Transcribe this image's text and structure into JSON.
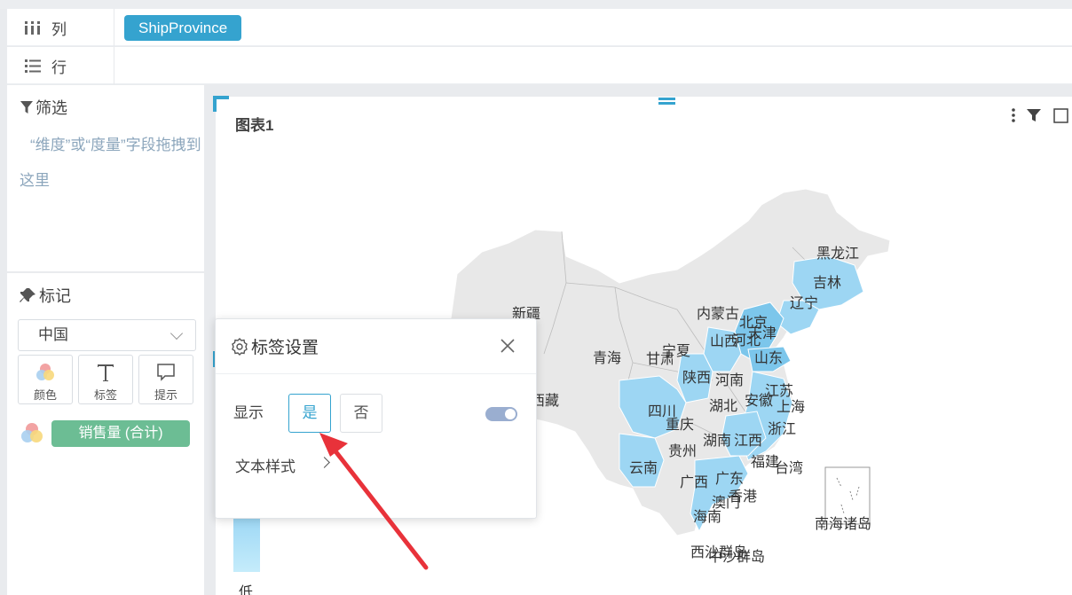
{
  "shelves": {
    "columns_label": "列",
    "columns_field": "ShipProvince",
    "rows_label": "行"
  },
  "filter": {
    "title": "筛选",
    "hint": "“维度”或“度量”字段拖拽到这里"
  },
  "marks": {
    "title": "标记",
    "map_select": "中国",
    "buttons": [
      {
        "label": "颜色",
        "icon": "color-circles-icon"
      },
      {
        "label": "标签",
        "icon": "text-T-icon"
      },
      {
        "label": "提示",
        "icon": "tooltip-bubble-icon"
      }
    ],
    "measure": "销售量 (合计)"
  },
  "chart": {
    "title": "图表1",
    "legend_low": "低",
    "labels": [
      "黑龙江",
      "吉林",
      "辽宁",
      "内蒙古",
      "北京",
      "天津",
      "河北",
      "山西",
      "宁夏",
      "新疆",
      "青海",
      "甘肃",
      "山东",
      "陕西",
      "河南",
      "江苏",
      "安徽",
      "上海",
      "西藏",
      "四川",
      "湖北",
      "重庆",
      "浙江",
      "湖南",
      "江西",
      "贵州",
      "福建",
      "台湾",
      "云南",
      "广西",
      "广东",
      "香港",
      "澳门",
      "海南",
      "南海诸岛",
      "西沙群岛",
      "中沙群岛"
    ],
    "colors": {
      "highlight": "#9dd6f3",
      "highlight_dark": "#7cc6eb",
      "base": "#e8e8e8"
    }
  },
  "popup": {
    "title": "标签设置",
    "show_label": "显示",
    "yes": "是",
    "no": "否",
    "text_style": "文本样式",
    "toggle_on": true
  }
}
